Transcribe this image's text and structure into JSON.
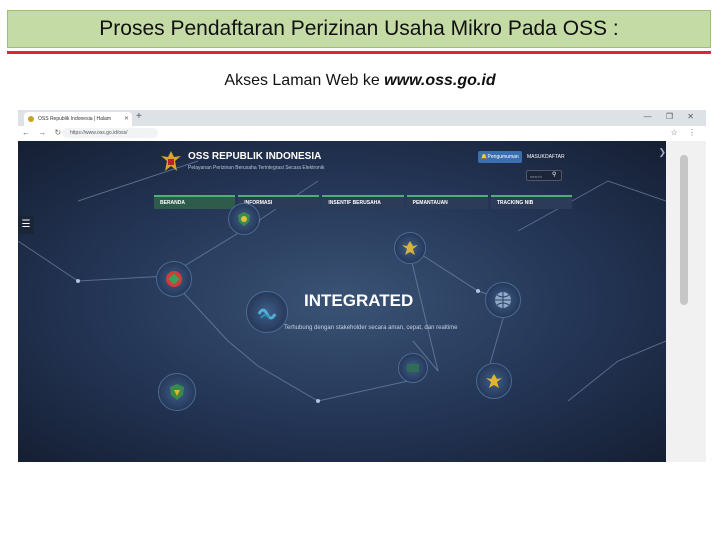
{
  "slide": {
    "title": "Proses Pendaftaran Perizinan Usaha Mikro Pada OSS :",
    "subtitle_prefix": "Akses Laman Web ke ",
    "subtitle_url": "www.oss.go.id"
  },
  "browser": {
    "tab_title": "OSS Republik Indonesia | Halam",
    "url": "https://www.oss.go.id/oss/"
  },
  "site": {
    "brand": "OSS REPUBLIK INDONESIA",
    "tagline": "Pelayanan Perizinan Berusaha Terintegrasi Secara Elektronik",
    "pengumuman": "Pengumuman",
    "masuk": "MASUK",
    "daftar": "DAFTAR",
    "search_placeholder": "search",
    "menu": [
      "BERANDA",
      "INFORMASI",
      "INSENTIF BERUSAHA",
      "PEMANTAUAN",
      "TRACKING NIB"
    ],
    "headline": "INTEGRATED",
    "subheadline": "Terhubung dengan stakeholder secara aman, cepat, dan realtime"
  },
  "colors": {
    "title_bg": "#c5dba6",
    "accent_red": "#d9282f",
    "site_bg": "#233454",
    "menu_accent": "#4caf73"
  }
}
